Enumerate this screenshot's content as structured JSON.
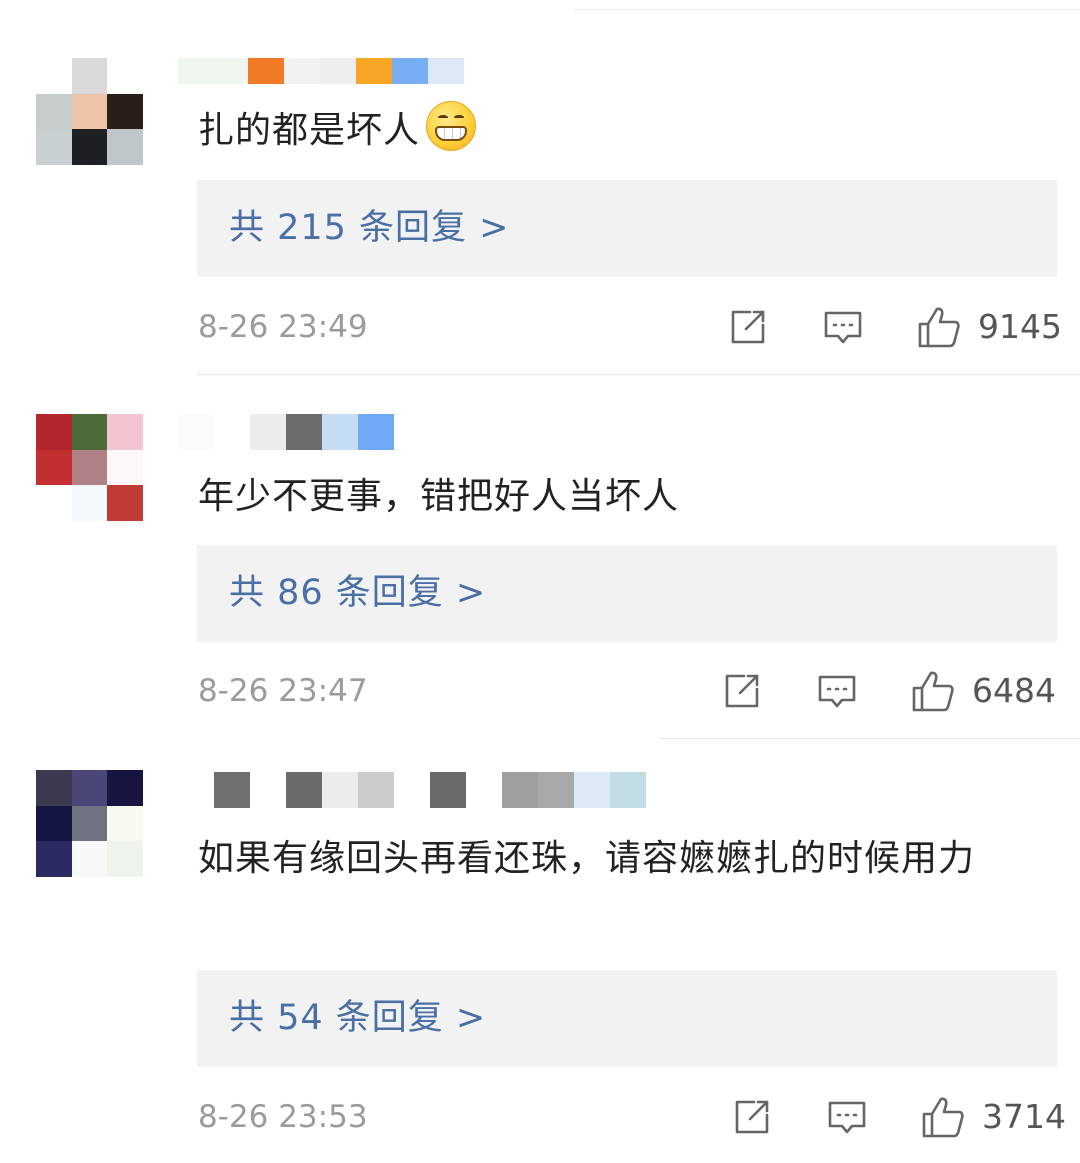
{
  "comments": [
    {
      "text": "扎的都是坏人",
      "has_emoji": true,
      "emoji": "grinning-face-icon",
      "reply_label": "共 215 条回复 >",
      "timestamp": "8-26 23:49",
      "likes": "9145"
    },
    {
      "text": "年少不更事，错把好人当坏人",
      "has_emoji": false,
      "reply_label": "共 86 条回复 >",
      "timestamp": "8-26 23:47",
      "likes": "6484"
    },
    {
      "text": "如果有缘回头再看还珠，请容嬷嬷扎的时候用力",
      "has_emoji": false,
      "reply_label": "共 54 条回复 >",
      "timestamp": "8-26 23:53",
      "likes": "3714"
    }
  ],
  "colors": {
    "reply_link": "#4a6fa5",
    "timestamp": "#9b9b9b",
    "reply_background": "#f2f2f2"
  },
  "icons": {
    "share": "share-icon",
    "reply": "comment-icon",
    "like": "thumbs-up-icon"
  }
}
